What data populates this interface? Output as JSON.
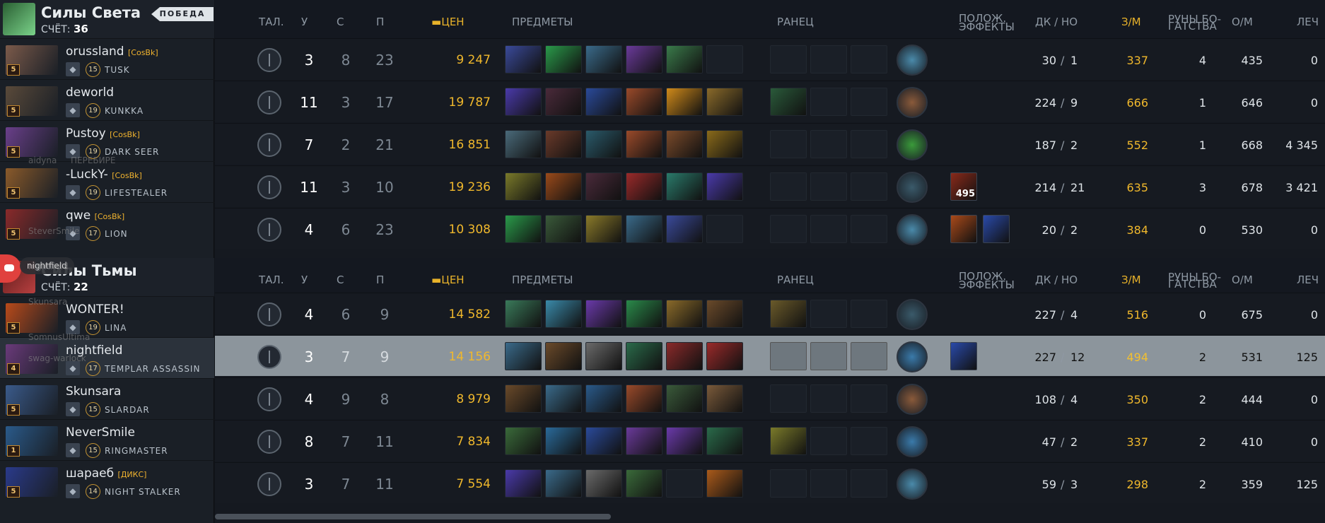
{
  "radiant": {
    "name": "Силы Света",
    "score_label": "СЧЁТ:",
    "score": "36",
    "badge": "ПОБЕДА",
    "crest_color": "#3f8f4a",
    "players": [
      {
        "name": "orussland",
        "tag": "[CosBk]",
        "level": "15",
        "hero": "TUSK",
        "hero_level": "5",
        "role_icon": "sword-icon",
        "color": "#7b5a4a"
      },
      {
        "name": "deworld",
        "tag": "",
        "level": "19",
        "hero": "KUNKKA",
        "hero_level": "5",
        "role_icon": "hourglass-icon",
        "color": "#5a4a3a"
      },
      {
        "name": "Pustoy",
        "tag": "[CosBk]",
        "level": "19",
        "hero": "DARK SEER",
        "hero_level": "5",
        "role_icon": "flag-icon",
        "color": "#6a3f8a"
      },
      {
        "name": "-LuckY-",
        "tag": "[CosBk]",
        "level": "19",
        "hero": "LIFESTEALER",
        "hero_level": "5",
        "role_icon": "heart-icon",
        "color": "#8a5a2a"
      },
      {
        "name": "qwe",
        "tag": "[CosBk]",
        "level": "17",
        "hero": "LION",
        "hero_level": "5",
        "role_icon": "hand-icon",
        "color": "#8a2a2a"
      }
    ]
  },
  "dire": {
    "name": "Силы Тьмы",
    "score_label": "СЧЁТ:",
    "score": "22",
    "crest_color": "#7a2424",
    "players": [
      {
        "name": "WONTER!",
        "tag": "",
        "level": "19",
        "hero": "LINA",
        "hero_level": "5",
        "role_icon": "sword-icon",
        "color": "#b84a1a"
      },
      {
        "name": "nightfield",
        "tag": "",
        "level": "17",
        "hero": "TEMPLAR ASSASSIN",
        "hero_level": "4",
        "role_icon": "hand-icon",
        "color": "#6a3a7a"
      },
      {
        "name": "Skunsara",
        "tag": "",
        "level": "15",
        "hero": "SLARDAR",
        "hero_level": "5",
        "role_icon": "shield-icon",
        "color": "#3a5a8a"
      },
      {
        "name": "NeverSmile",
        "tag": "",
        "level": "15",
        "hero": "RINGMASTER",
        "hero_level": "1",
        "role_icon": "hand-icon",
        "color": "#2a5a8a"
      },
      {
        "name": "шараеб",
        "tag": "[ДИКС]",
        "level": "14",
        "hero": "NIGHT STALKER",
        "hero_level": "5",
        "role_icon": "moon-icon",
        "color": "#2a3a8a"
      }
    ]
  },
  "headers": {
    "talents": "ТАЛ.",
    "kills": "У",
    "deaths": "С",
    "assists": "П",
    "networth": "ЦЕН",
    "items": "ПРЕДМЕТЫ",
    "backpack": "РАНЕЦ",
    "effects_1": "ПОЛОЖ.",
    "effects_2": "ЭФФЕКТЫ",
    "lh_dn": "ДК  /  НО",
    "gpm": "З/М",
    "runes_1": "РУНЫ БО-",
    "runes_2": "ГАТСТВА",
    "xpm": "О/М",
    "heal": "ЛЕЧ"
  },
  "radiant_rows": [
    {
      "k": "3",
      "d": "8",
      "a": "23",
      "nw": "9 247",
      "items": [
        "#3a4a9a",
        "#2a9a4a",
        "#3a6a8a",
        "#6a3a9a",
        "#3a7a4a",
        ""
      ],
      "bp": [
        "",
        "",
        ""
      ],
      "neutral": "#4a8aaa",
      "buffs": [],
      "lh": "30",
      "dn": "1",
      "gpm": "337",
      "runes": "4",
      "xpm": "435",
      "heal": "0"
    },
    {
      "k": "11",
      "d": "3",
      "a": "17",
      "nw": "19 787",
      "items": [
        "#4a3aaa",
        "#4a2a3a",
        "#2a4a9a",
        "#9a4a2a",
        "#d08a1a",
        "#8a6a2a"
      ],
      "bp": [
        "#2a5a3a",
        "",
        ""
      ],
      "neutral": "#8a5a3a",
      "buffs": [],
      "lh": "224",
      "dn": "9",
      "gpm": "666",
      "runes": "1",
      "xpm": "646",
      "heal": "0"
    },
    {
      "k": "7",
      "d": "2",
      "a": "21",
      "nw": "16 851",
      "items": [
        "#4a6a7a",
        "#6a3a2a",
        "#2a5a6a",
        "#9a4a2a",
        "#7a4a2a",
        "#8a6a1a"
      ],
      "bp": [
        "",
        "",
        ""
      ],
      "neutral": "#3a9a3a",
      "buffs": [],
      "lh": "187",
      "dn": "2",
      "gpm": "552",
      "runes": "1",
      "xpm": "668",
      "heal": "4 345"
    },
    {
      "k": "11",
      "d": "3",
      "a": "10",
      "nw": "19 236",
      "items": [
        "#7a7a2a",
        "#9a4a1a",
        "#4a2a3a",
        "#9a2a2a",
        "#2a7a6a",
        "#4a3aaa"
      ],
      "bp": [
        "",
        "",
        ""
      ],
      "neutral": "#3a5a6a",
      "buffs": [
        {
          "color": "#8a2a1a",
          "count": "495"
        }
      ],
      "lh": "214",
      "dn": "21",
      "gpm": "635",
      "runes": "3",
      "xpm": "678",
      "heal": "3 421"
    },
    {
      "k": "4",
      "d": "6",
      "a": "23",
      "nw": "10 308",
      "items": [
        "#2a9a4a",
        "#3a5a3a",
        "#8a7a2a",
        "#3a6a8a",
        "#3a4a9a",
        ""
      ],
      "bp": [
        "",
        "",
        ""
      ],
      "neutral": "#4a8aaa",
      "buffs": [
        {
          "color": "#aa4a1a",
          "count": ""
        },
        {
          "color": "#2a4aaa",
          "count": ""
        }
      ],
      "lh": "20",
      "dn": "2",
      "gpm": "384",
      "runes": "0",
      "xpm": "530",
      "heal": "0"
    }
  ],
  "dire_rows": [
    {
      "k": "4",
      "d": "6",
      "a": "9",
      "nw": "14 582",
      "items": [
        "#3a7a5a",
        "#3a8aaa",
        "#6a3aaa",
        "#2a8a4a",
        "#8a6a2a",
        "#6a4a2a"
      ],
      "bp": [
        "#6a5a2a",
        "",
        ""
      ],
      "neutral": "#3a5a6a",
      "buffs": [],
      "lh": "227",
      "dn": "4",
      "gpm": "516",
      "runes": "0",
      "xpm": "675",
      "heal": "0"
    },
    {
      "k": "3",
      "d": "7",
      "a": "9",
      "nw": "14 156",
      "items": [
        "#3a6a8a",
        "#6a4a2a",
        "#6a6a6a",
        "#2a6a4a",
        "#8a2a2a",
        "#9a2a2a"
      ],
      "bp": [
        "",
        "",
        ""
      ],
      "neutral": "#3a7aaa",
      "buffs": [
        {
          "color": "#2a4aaa",
          "count": ""
        }
      ],
      "lh": "227",
      "dn": "12",
      "gpm": "494",
      "runes": "2",
      "xpm": "531",
      "heal": "125"
    },
    {
      "k": "4",
      "d": "9",
      "a": "8",
      "nw": "8 979",
      "items": [
        "#6a4a2a",
        "#3a6a8a",
        "#2a5a8a",
        "#9a4a2a",
        "#3a5a3a",
        "#7a5a3a"
      ],
      "bp": [
        "",
        "",
        ""
      ],
      "neutral": "#8a5a3a",
      "buffs": [],
      "lh": "108",
      "dn": "4",
      "gpm": "350",
      "runes": "2",
      "xpm": "444",
      "heal": "0"
    },
    {
      "k": "8",
      "d": "7",
      "a": "11",
      "nw": "7 834",
      "items": [
        "#3a6a3a",
        "#2a6a9a",
        "#2a4a9a",
        "#6a3a9a",
        "#6a3aaa",
        "#2a6a4a"
      ],
      "bp": [
        "#7a7a2a",
        "",
        ""
      ],
      "neutral": "#3a7aaa",
      "buffs": [],
      "lh": "47",
      "dn": "2",
      "gpm": "337",
      "runes": "2",
      "xpm": "410",
      "heal": "0"
    },
    {
      "k": "3",
      "d": "7",
      "a": "11",
      "nw": "7 554",
      "items": [
        "#4a3aaa",
        "#3a6a8a",
        "#6a6a6a",
        "#3a6a3a",
        "",
        "#aa5a1a"
      ],
      "bp": [
        "",
        "",
        ""
      ],
      "neutral": "#4a8aaa",
      "buffs": [],
      "lh": "59",
      "dn": "3",
      "gpm": "298",
      "runes": "2",
      "xpm": "359",
      "heal": "125"
    }
  ],
  "overlay": {
    "names": [
      "aidyna",
      "SteverSmile",
      "nightfield",
      "Skunsara",
      "SomnusUltima",
      "swag-warlock",
      "ПЕРЕБИРЕ"
    ],
    "discord_user": "nightfield"
  }
}
